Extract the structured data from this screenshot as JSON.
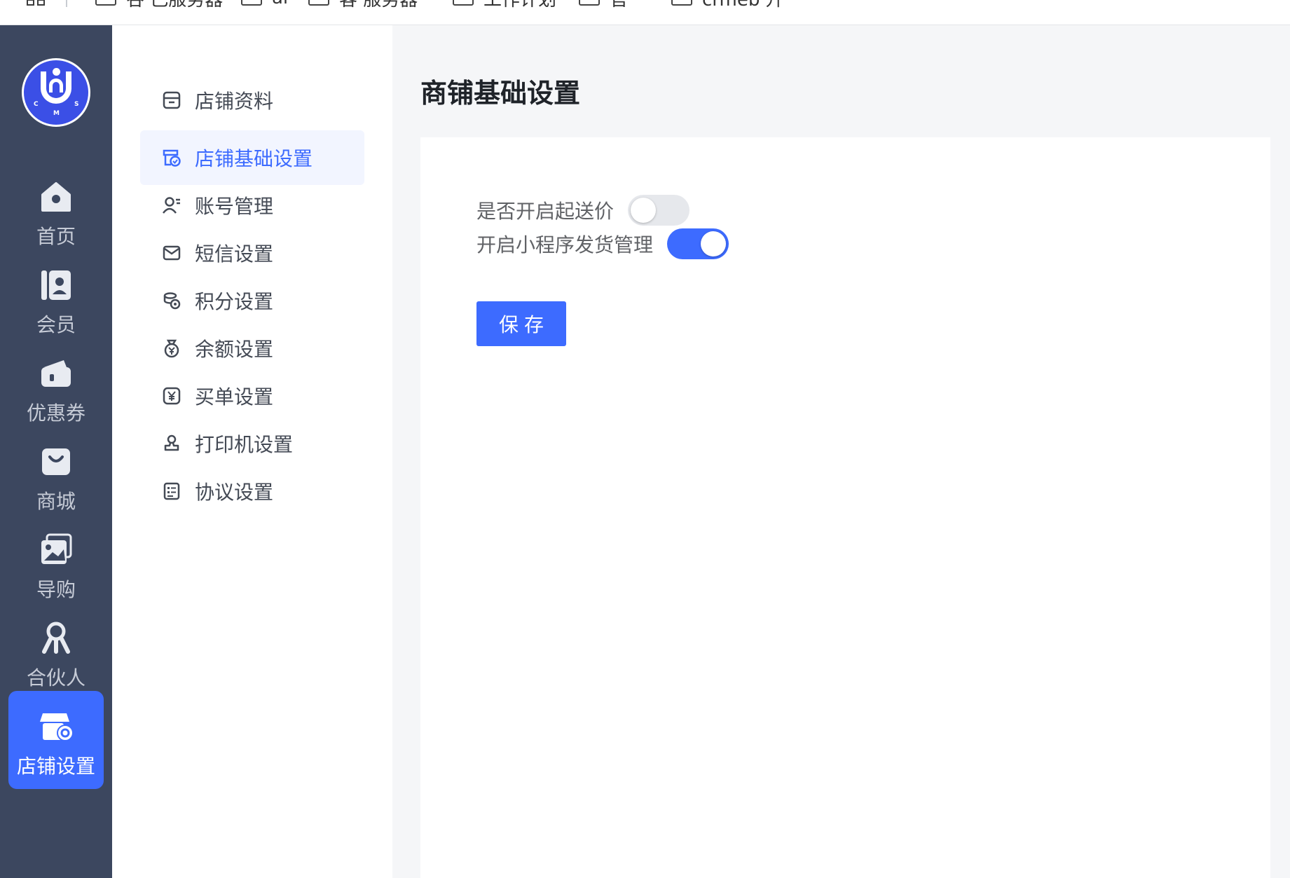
{
  "bookmarks": [
    "谷 己服务器",
    "ai",
    "客 服务器",
    "工作计划",
    "官 ",
    "crmeb 升"
  ],
  "rail": {
    "logo_letters": [
      "C",
      "M",
      "S"
    ],
    "items": [
      {
        "label": "首页",
        "icon": "home-icon"
      },
      {
        "label": "会员",
        "icon": "member-book-icon"
      },
      {
        "label": "优惠券",
        "icon": "coupon-wallet-icon"
      },
      {
        "label": "商城",
        "icon": "shopping-bag-icon"
      },
      {
        "label": "导购",
        "icon": "gallery-icon"
      },
      {
        "label": "合伙人",
        "icon": "partners-icon"
      },
      {
        "label": "店铺设置",
        "icon": "store-settings-icon",
        "active": true
      }
    ]
  },
  "submenu": {
    "items": [
      {
        "label": "店铺资料",
        "icon": "store-info-icon"
      },
      {
        "label": "店铺基础设置",
        "icon": "store-basic-icon",
        "active": true
      },
      {
        "label": "账号管理",
        "icon": "account-icon"
      },
      {
        "label": "短信设置",
        "icon": "mail-icon"
      },
      {
        "label": "积分设置",
        "icon": "points-icon"
      },
      {
        "label": "余额设置",
        "icon": "balance-icon"
      },
      {
        "label": "买单设置",
        "icon": "yen-icon"
      },
      {
        "label": "打印机设置",
        "icon": "stamp-icon"
      },
      {
        "label": "协议设置",
        "icon": "document-list-icon"
      }
    ]
  },
  "main": {
    "title": "商铺基础设置",
    "settings": [
      {
        "label": "是否开启起送价",
        "enabled": false
      },
      {
        "label": "开启小程序发货管理",
        "enabled": true
      }
    ],
    "save_label": "保存"
  },
  "colors": {
    "accent": "#3d6bff",
    "rail_bg": "#3c475f",
    "page_bg": "#f5f6f8"
  }
}
